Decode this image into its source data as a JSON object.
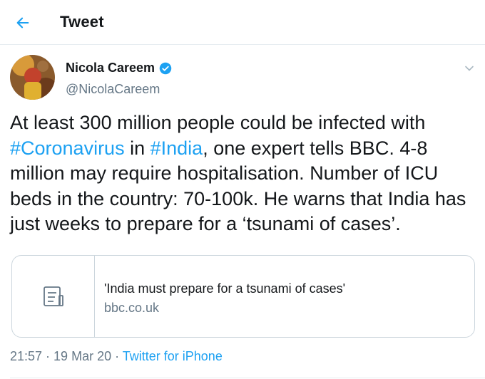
{
  "header": {
    "title": "Tweet",
    "back_icon": "arrow-left-icon"
  },
  "author": {
    "name": "Nicola Careem",
    "handle": "@NicolaCareem",
    "verified": true
  },
  "tweet": {
    "line1": "At least 300 million people could be infected with",
    "hashtag1": "#Coronavirus",
    "in_word": " in ",
    "hashtag2": "#India",
    "after_tags": ", one expert tells BBC. 4-8 million may require hospitalisation. Number of ICU beds in the country: 70-100k. He warns that India has just weeks to prepare for a ‘tsunami of cases’."
  },
  "card": {
    "title": "'India must prepare for a tsunami of cases'",
    "domain": "bbc.co.uk",
    "icon": "document-icon"
  },
  "meta": {
    "time": "21:57",
    "date": "19 Mar 20",
    "separator": " · ",
    "source": "Twitter for iPhone"
  },
  "colors": {
    "accent": "#1da1f2",
    "muted": "#657786",
    "text": "#14171a"
  }
}
